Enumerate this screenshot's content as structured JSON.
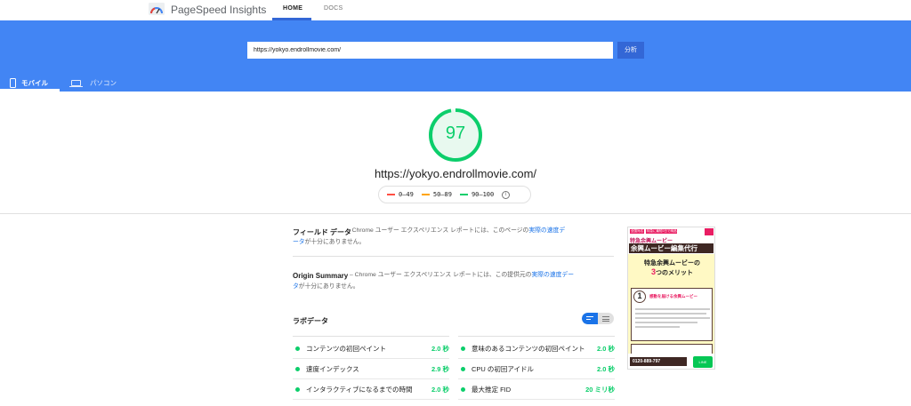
{
  "header": {
    "app_title": "PageSpeed Insights",
    "nav": [
      {
        "label": "HOME"
      },
      {
        "label": "DOCS"
      }
    ]
  },
  "search": {
    "url_value": "https://yokyo.endrollmovie.com/",
    "analyze_label": "分析"
  },
  "device_tabs": [
    {
      "label": "モバイル",
      "icon": "phone-icon",
      "active": true
    },
    {
      "label": "パソコン",
      "icon": "laptop-icon",
      "active": false
    }
  ],
  "score": {
    "value": "97",
    "color": "#0cce6b",
    "fraction": 0.97,
    "url": "https://yokyo.endrollmovie.com/"
  },
  "legend": [
    {
      "label": "0–49",
      "color": "#ff4e42"
    },
    {
      "label": "50–89",
      "color": "#ffa400"
    },
    {
      "label": "90–100",
      "color": "#0cce6b"
    }
  ],
  "field_data": {
    "title": "フィールド データ",
    "desc_prefix": " – Chrome ユーザー エクスペリエンス レポートには、このページの",
    "desc_link": "実際の速度デ",
    "desc_line2_link": "ータ",
    "desc_line2_rest": "が十分にありません。"
  },
  "origin_summary": {
    "title": "Origin Summary",
    "desc_prefix": " – Chrome ユーザー エクスペリエンス レポートには、この提供元の",
    "desc_link": "実際の速度デー",
    "desc_line2_link": "タ",
    "desc_line2_rest": "が十分にありません。"
  },
  "lab_data": {
    "title": "ラボデータ",
    "metrics": [
      {
        "label": "コンテンツの初回ペイント",
        "value": "2.0 秒"
      },
      {
        "label": "意味のあるコンテンツの初回ペイント",
        "value": "2.0 秒"
      },
      {
        "label": "速度インデックス",
        "value": "2.9 秒"
      },
      {
        "label": "CPU の初回アイドル",
        "value": "2.0 秒"
      },
      {
        "label": "インタラクティブになるまでの時間",
        "value": "2.0 秒"
      },
      {
        "label": "最大推定 FID",
        "value": "20 ミリ秒"
      }
    ]
  },
  "screenshot": {
    "badge_left": "全国対応",
    "badge_right": "特急に最短2日で納品",
    "heading1": "特急余興ムービー",
    "heading2": "余興ムービー編集代行",
    "merit_title": "特急余興ムービーの",
    "merit_number": "3",
    "merit_suffix": "つのメリット",
    "card_number": "1",
    "card_title": "感動を届ける余興ムービー",
    "phone_label": "0120-889-797",
    "line_label": "LINE"
  }
}
